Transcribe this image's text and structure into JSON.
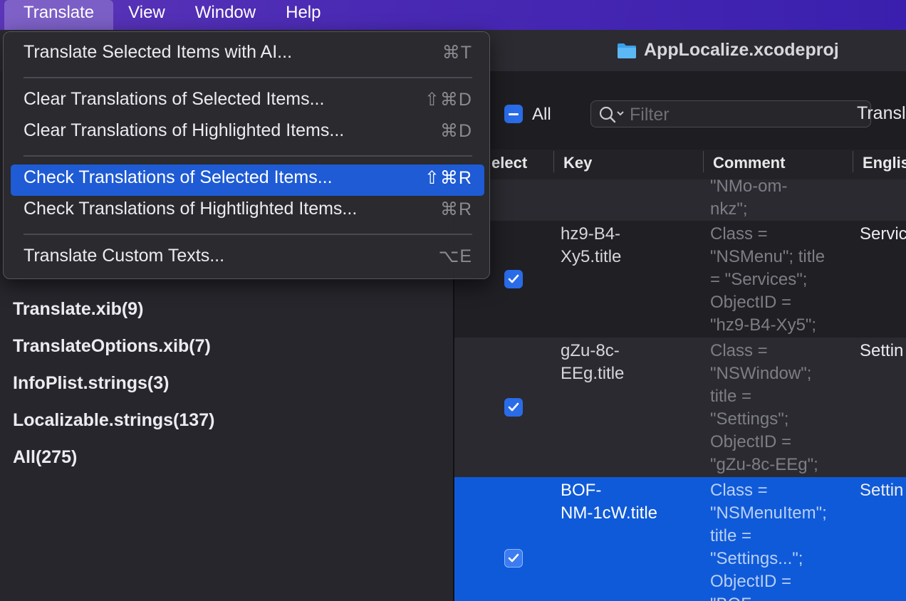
{
  "menubar": {
    "items": [
      "Translate",
      "View",
      "Window",
      "Help"
    ],
    "active": "Translate"
  },
  "window": {
    "title": "AppLocalize.xcodeproj",
    "title_icon": "folder-icon"
  },
  "dropdown": {
    "items": [
      {
        "label": "Translate Selected Items with AI...",
        "shortcut": "⌘T"
      },
      {
        "label": "Clear Translations of Selected Items...",
        "shortcut": "⇧⌘D"
      },
      {
        "label": "Clear Translations of Highlighted Items...",
        "shortcut": "⌘D"
      },
      {
        "label": "Check Translations of Selected Items...",
        "shortcut": "⇧⌘R",
        "highlighted": true
      },
      {
        "label": "Check Translations of Hightlighted Items...",
        "shortcut": "⌘R"
      },
      {
        "label": "Translate Custom Texts...",
        "shortcut": "⌥E"
      }
    ]
  },
  "sidebar": {
    "files": [
      "Translate.xib(9)",
      "TranslateOptions.xib(7)",
      "InfoPlist.strings(3)",
      "Localizable.strings(137)",
      "All(275)"
    ]
  },
  "filterbar": {
    "all_label": "All",
    "all_state": "mixed",
    "filter_placeholder": "Filter",
    "translate_label": "Transl"
  },
  "table": {
    "columns": [
      "elect",
      "Key",
      "Comment",
      "Englis"
    ],
    "rows": [
      {
        "key": "",
        "comment": "\"NMo-om-\nnkz\";",
        "english": "",
        "checked": null,
        "selected": false
      },
      {
        "key": "hz9-B4-\nXy5.title",
        "comment": "Class =\n\"NSMenu\"; title\n= \"Services\";\nObjectID =\n\"hz9-B4-Xy5\";",
        "english": "Servic",
        "checked": true,
        "selected": false
      },
      {
        "key": "gZu-8c-\nEEg.title",
        "comment": "Class =\n\"NSWindow\";\ntitle =\n\"Settings\";\nObjectID =\n\"gZu-8c-EEg\";",
        "english": "Settin",
        "checked": true,
        "selected": false
      },
      {
        "key": "BOF-\nNM-1cW.title",
        "comment": "Class =\n\"NSMenuItem\";\ntitle =\n\"Settings...\";\nObjectID =\n\"BOF-",
        "english": "Settin",
        "checked": true,
        "selected": true
      }
    ]
  },
  "colors": {
    "menubar_start": "#5b35b8",
    "menubar_end": "#3a1fae",
    "accent": "#1e5bd4",
    "selected_row": "#0f5ad8",
    "checkbox": "#2a6ce8"
  }
}
